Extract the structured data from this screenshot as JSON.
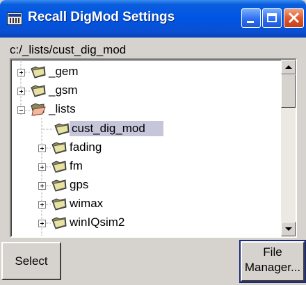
{
  "window": {
    "title": "Recall DigMod Settings",
    "icon": "digital-settings-app-icon"
  },
  "title_buttons": {
    "minimize_icon": "minimize-icon",
    "maximize_icon": "maximize-icon",
    "close_icon": "close-icon"
  },
  "path": "c:/_lists/cust_dig_mod",
  "tree": {
    "items": [
      {
        "label": "_gem",
        "expander": "plus",
        "folder_state": "closed"
      },
      {
        "label": "_gsm",
        "expander": "plus",
        "folder_state": "closed"
      },
      {
        "label": "_lists",
        "expander": "minus",
        "folder_state": "open"
      },
      {
        "label": "cust_dig_mod",
        "expander": "none",
        "folder_state": "closed",
        "selected": true
      },
      {
        "label": "fading",
        "expander": "plus",
        "folder_state": "closed"
      },
      {
        "label": "fm",
        "expander": "plus",
        "folder_state": "closed"
      },
      {
        "label": "gps",
        "expander": "plus",
        "folder_state": "closed"
      },
      {
        "label": "wimax",
        "expander": "plus",
        "folder_state": "closed"
      },
      {
        "label": "winIQsim2",
        "expander": "plus",
        "folder_state": "closed"
      }
    ]
  },
  "buttons": {
    "select_label": "Select",
    "file_manager_line1": "File",
    "file_manager_line2": "Manager..."
  },
  "colors": {
    "titlebar": "#0055e5",
    "close_button": "#e0582c",
    "selection": "#c6c5d9",
    "dialog_bg": "#d6d3ce"
  }
}
